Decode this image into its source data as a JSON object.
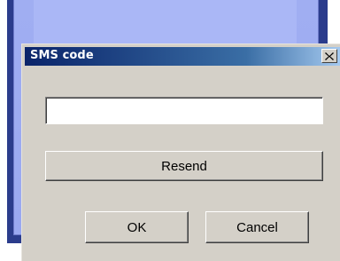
{
  "dialog": {
    "title": "SMS code",
    "close_icon": "close-icon"
  },
  "code_field": {
    "value": "",
    "placeholder": ""
  },
  "buttons": {
    "resend_label": "Resend",
    "ok_label": "OK",
    "cancel_label": "Cancel"
  },
  "colors": {
    "dialog_face": "#d4d0c8",
    "titlebar_start": "#0a246a",
    "titlebar_end": "#a6caf0",
    "background_panel": "#a0aef2"
  }
}
